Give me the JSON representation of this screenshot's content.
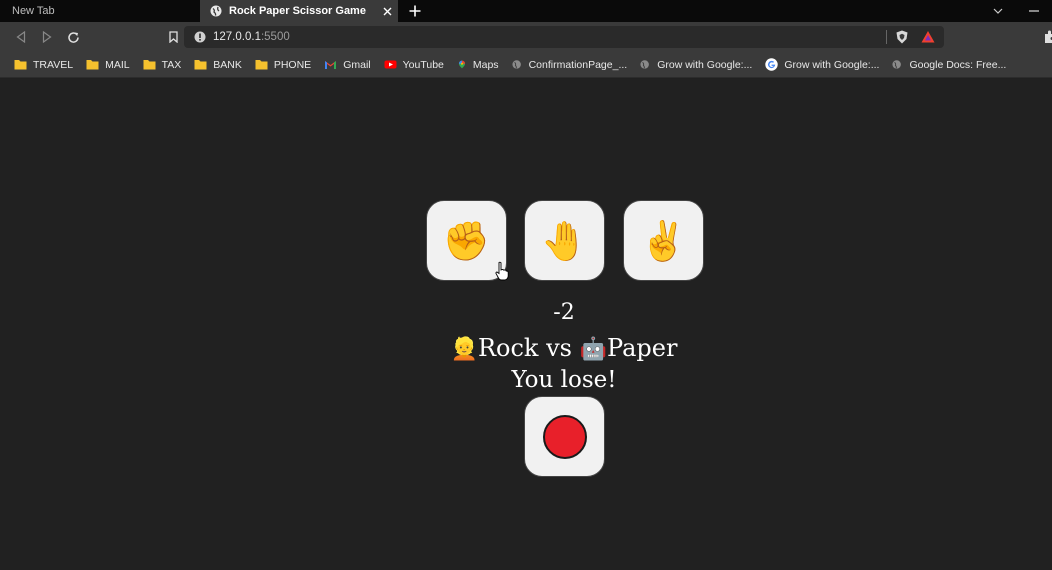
{
  "browser": {
    "tabs": [
      {
        "title": "New Tab",
        "active": false
      },
      {
        "title": "Rock Paper Scissor Game",
        "active": true
      }
    ],
    "address": {
      "host": "127.0.0.1",
      "port": ":5500"
    },
    "bookmarks": [
      {
        "label": "TRAVEL",
        "icon": "folder-icon"
      },
      {
        "label": "MAIL",
        "icon": "folder-icon"
      },
      {
        "label": "TAX",
        "icon": "folder-icon"
      },
      {
        "label": "BANK",
        "icon": "folder-icon"
      },
      {
        "label": "PHONE",
        "icon": "folder-icon"
      },
      {
        "label": "Gmail",
        "icon": "gmail-icon"
      },
      {
        "label": "YouTube",
        "icon": "youtube-icon"
      },
      {
        "label": "Maps",
        "icon": "maps-icon"
      },
      {
        "label": "ConfirmationPage_...",
        "icon": "globe-icon"
      },
      {
        "label": "Grow with Google:...",
        "icon": "globe-icon"
      },
      {
        "label": "Grow with Google:...",
        "icon": "google-icon"
      },
      {
        "label": "Google Docs: Free...",
        "icon": "globe-icon"
      }
    ]
  },
  "game": {
    "choices": [
      {
        "name": "Rock",
        "emoji": "✊"
      },
      {
        "name": "Paper",
        "emoji": "🤚"
      },
      {
        "name": "Scissors",
        "emoji": "✌️"
      }
    ],
    "score": "-2",
    "player_emoji": "👱",
    "player_choice": "Rock",
    "vs": "vs",
    "computer_emoji": "🤖",
    "computer_choice": "Paper",
    "result": "You lose!",
    "reset_icon": "red-circle-icon"
  },
  "colors": {
    "page_bg": "#212121",
    "button_bg": "#f1f1f1",
    "reset_dot": "#e8202a",
    "folder": "#f5c12e"
  }
}
